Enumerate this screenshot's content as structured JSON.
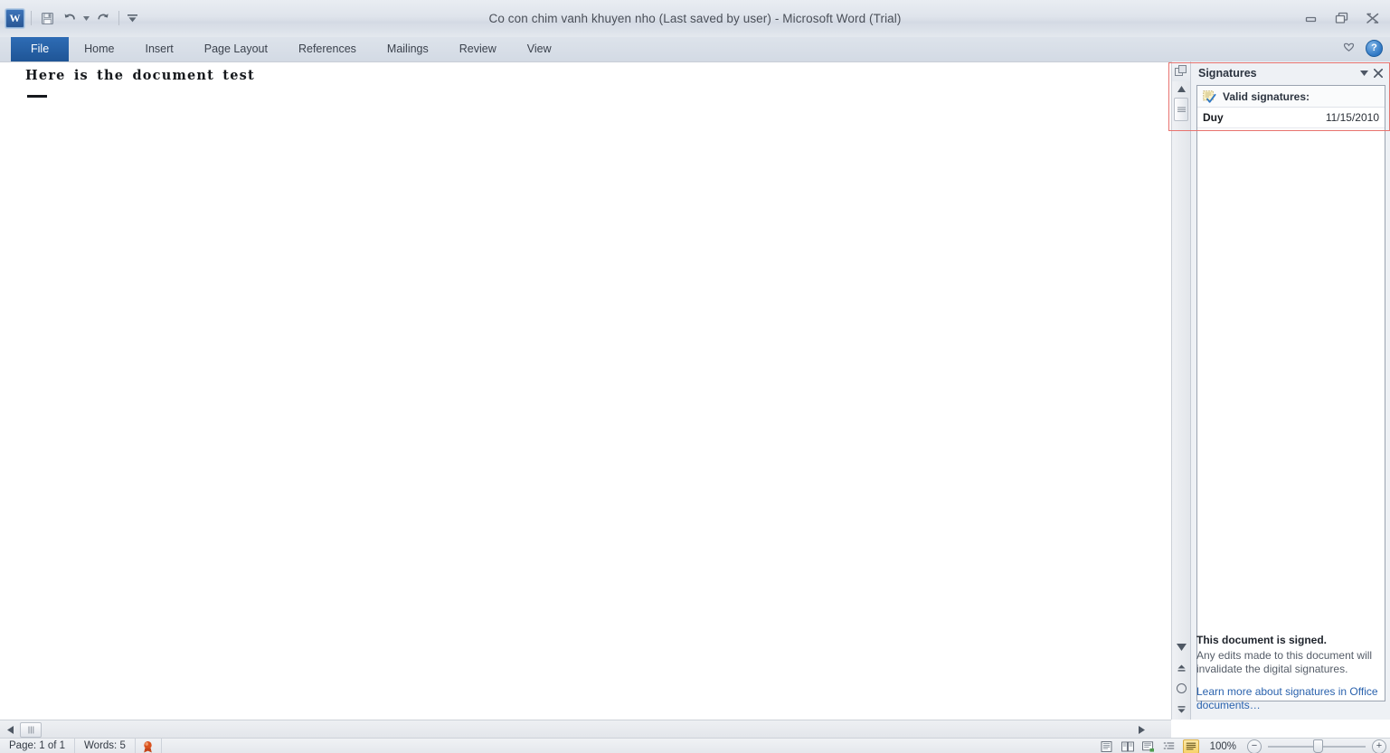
{
  "window": {
    "title": "Co con chim vanh khuyen nho (Last saved by user)  -  Microsoft Word (Trial)",
    "minimize_label": "Minimize",
    "restore_label": "Restore Down",
    "close_label": "Close"
  },
  "quick_access": {
    "logo_label": "W",
    "save_label": "Save",
    "undo_label": "Undo",
    "undo_dropdown_label": "Undo options",
    "redo_label": "Repeat",
    "customize_label": "Customize Quick Access Toolbar"
  },
  "ribbon": {
    "tabs": [
      {
        "label": "File"
      },
      {
        "label": "Home"
      },
      {
        "label": "Insert"
      },
      {
        "label": "Page Layout"
      },
      {
        "label": "References"
      },
      {
        "label": "Mailings"
      },
      {
        "label": "Review"
      },
      {
        "label": "View"
      }
    ],
    "minimize_ribbon_label": "Minimize the Ribbon",
    "help_label": "?"
  },
  "document": {
    "body_text": "Here is the document test",
    "signature_line_label": "signature line"
  },
  "pane": {
    "title": "Signatures",
    "menu_label": "Task Pane Options",
    "close_label": "Close",
    "group_label": "Valid signatures:",
    "signatures": [
      {
        "name": "Duy",
        "date": "11/15/2010"
      }
    ],
    "footer_heading": "This document is signed.",
    "footer_body": "Any edits made to this document will invalidate the digital signatures.",
    "footer_link": "Learn more about signatures in Office documents…"
  },
  "status_bar": {
    "page": "Page: 1 of 1",
    "words": "Words: 5",
    "signature_icon_label": "signature-seal",
    "views": [
      {
        "name": "print-layout"
      },
      {
        "name": "full-screen-reading"
      },
      {
        "name": "web-layout"
      },
      {
        "name": "outline"
      },
      {
        "name": "draft"
      }
    ],
    "zoom_level": "100%",
    "zoom_out_label": "−",
    "zoom_in_label": "+"
  },
  "scrollbars": {
    "select_browse_object_label": "Select Browse Object",
    "previous_page_label": "Previous Page",
    "next_page_label": "Next Page",
    "scroll_up_label": "Scroll Up",
    "scroll_down_label": "Scroll Down",
    "scroll_left_label": "Scroll Left",
    "scroll_right_label": "Scroll Right"
  },
  "colors": {
    "accent_blue": "#2e6cb5",
    "highlight_red": "#e8736f",
    "link_blue": "#2a62ad",
    "active_view_yellow": "#f7d26a"
  }
}
